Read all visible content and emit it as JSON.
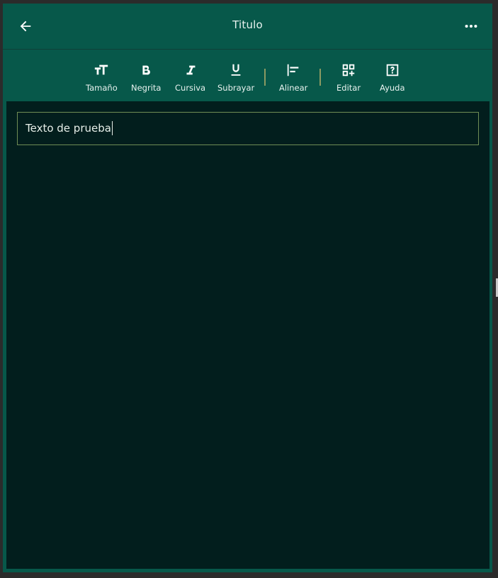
{
  "header": {
    "title": "Titulo",
    "back_icon": "arrow-left-icon",
    "more_icon": "more-horizontal-icon"
  },
  "toolbar": {
    "items": [
      {
        "label": "Tamaño",
        "icon": "text-size-icon"
      },
      {
        "label": "Negrita",
        "icon": "bold-icon"
      },
      {
        "label": "Cursiva",
        "icon": "italic-icon"
      },
      {
        "label": "Subrayar",
        "icon": "underline-icon"
      },
      {
        "label": "Alinear",
        "icon": "align-left-icon"
      },
      {
        "label": "Editar",
        "icon": "grid-plus-icon"
      },
      {
        "label": "Ayuda",
        "icon": "help-box-icon"
      }
    ]
  },
  "editor": {
    "text": "Texto de prueba"
  },
  "colors": {
    "header_bg": "#07584a",
    "editor_bg": "#021e1d",
    "separator": "#8b9a62",
    "input_border": "#6f8d55",
    "text": "#e8f2ef"
  }
}
